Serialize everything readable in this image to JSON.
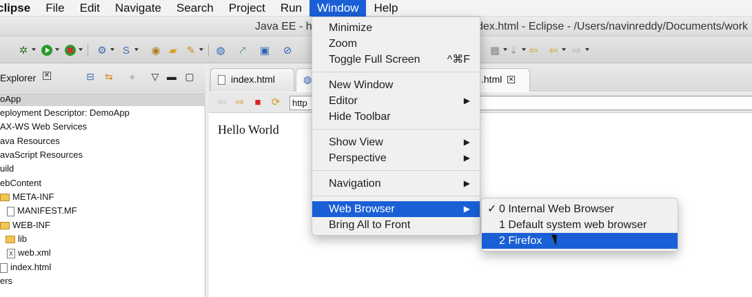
{
  "menubar": {
    "app": "clipse",
    "items": [
      "File",
      "Edit",
      "Navigate",
      "Search",
      "Project",
      "Run",
      "Window",
      "Help"
    ],
    "active": "Window"
  },
  "titlebar": {
    "left": "Java EE - ht",
    "right": "dex.html - Eclipse - /Users/navinreddy/Documents/work"
  },
  "explorer": {
    "title": "Explorer",
    "tree": [
      {
        "label": "oApp",
        "type": "project",
        "selected": true
      },
      {
        "label": "eployment Descriptor: DemoApp",
        "type": "node"
      },
      {
        "label": "AX-WS Web Services",
        "type": "node"
      },
      {
        "label": "ava Resources",
        "type": "node"
      },
      {
        "label": "avaScript Resources",
        "type": "node"
      },
      {
        "label": "uild",
        "type": "node"
      },
      {
        "label": "ebContent",
        "type": "node"
      },
      {
        "label": "META-INF",
        "type": "folder"
      },
      {
        "label": "MANIFEST.MF",
        "type": "file"
      },
      {
        "label": "WEB-INF",
        "type": "folder"
      },
      {
        "label": "lib",
        "type": "folder"
      },
      {
        "label": "web.xml",
        "type": "xfile"
      },
      {
        "label": "index.html",
        "type": "file"
      },
      {
        "label": "ers",
        "type": "node"
      }
    ]
  },
  "editor": {
    "tabs": [
      {
        "label": "index.html"
      },
      {
        "label": ".html"
      }
    ],
    "url": "http",
    "content": "Hello World"
  },
  "window_menu": {
    "groups": [
      [
        {
          "label": "Minimize"
        },
        {
          "label": "Zoom"
        },
        {
          "label": "Toggle Full Screen",
          "shortcut": "^⌘F"
        }
      ],
      [
        {
          "label": "New Window"
        },
        {
          "label": "Editor",
          "submenu": true
        },
        {
          "label": "Hide Toolbar"
        }
      ],
      [
        {
          "label": "Show View",
          "submenu": true
        },
        {
          "label": "Perspective",
          "submenu": true
        }
      ],
      [
        {
          "label": "Navigation",
          "submenu": true
        }
      ],
      [
        {
          "label": "Web Browser",
          "submenu": true,
          "highlighted": true
        },
        {
          "label": "Bring All to Front"
        }
      ]
    ]
  },
  "web_browser_submenu": {
    "items": [
      {
        "label": "0 Internal Web Browser",
        "checked": true
      },
      {
        "label": "1 Default system web browser"
      },
      {
        "label": "2 Firefox",
        "highlighted": true
      }
    ]
  },
  "colors": {
    "highlight": "#1a5fd6",
    "menu_bg": "#f0f0f0"
  }
}
